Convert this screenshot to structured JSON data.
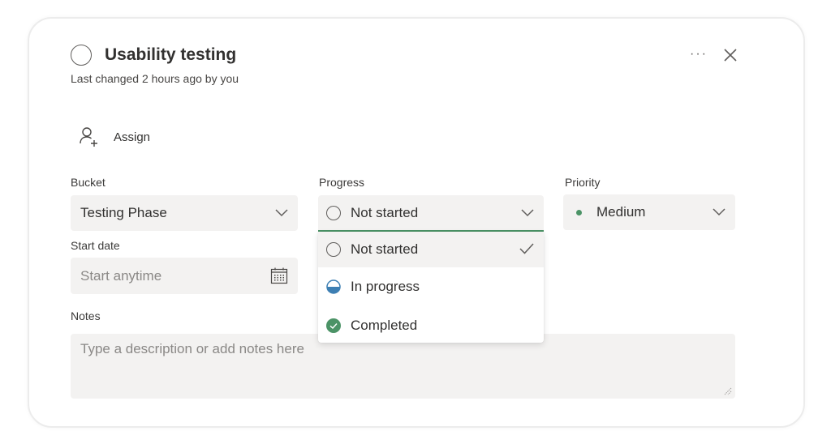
{
  "task": {
    "title": "Usability testing",
    "last_changed": "Last changed 2 hours ago by you",
    "more_label": "···"
  },
  "assign": {
    "label": "Assign"
  },
  "fields": {
    "bucket": {
      "label": "Bucket",
      "value": "Testing Phase"
    },
    "progress": {
      "label": "Progress",
      "value": "Not started"
    },
    "priority": {
      "label": "Priority",
      "value": "Medium",
      "color": "#4b9366"
    },
    "start_date": {
      "label": "Start date",
      "placeholder": "Start anytime"
    },
    "notes": {
      "label": "Notes",
      "placeholder": "Type a description or add notes here"
    }
  },
  "progress_options": [
    {
      "label": "Not started",
      "icon": "empty-circle-icon",
      "selected": true
    },
    {
      "label": "In progress",
      "icon": "half-filled-circle-icon",
      "selected": false
    },
    {
      "label": "Completed",
      "icon": "check-circle-icon",
      "selected": false
    }
  ],
  "colors": {
    "accent_green": "#4b9366",
    "in_progress_blue": "#3d7fb3",
    "field_bg": "#f3f2f1"
  }
}
